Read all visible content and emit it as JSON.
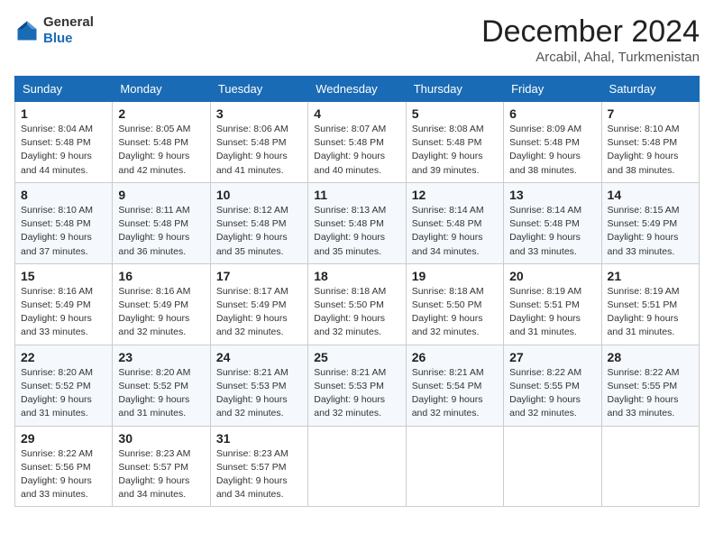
{
  "header": {
    "logo_line1": "General",
    "logo_line2": "Blue",
    "month_title": "December 2024",
    "location": "Arcabil, Ahal, Turkmenistan"
  },
  "weekdays": [
    "Sunday",
    "Monday",
    "Tuesday",
    "Wednesday",
    "Thursday",
    "Friday",
    "Saturday"
  ],
  "weeks": [
    [
      {
        "day": "1",
        "sunrise": "8:04 AM",
        "sunset": "5:48 PM",
        "daylight": "9 hours and 44 minutes."
      },
      {
        "day": "2",
        "sunrise": "8:05 AM",
        "sunset": "5:48 PM",
        "daylight": "9 hours and 42 minutes."
      },
      {
        "day": "3",
        "sunrise": "8:06 AM",
        "sunset": "5:48 PM",
        "daylight": "9 hours and 41 minutes."
      },
      {
        "day": "4",
        "sunrise": "8:07 AM",
        "sunset": "5:48 PM",
        "daylight": "9 hours and 40 minutes."
      },
      {
        "day": "5",
        "sunrise": "8:08 AM",
        "sunset": "5:48 PM",
        "daylight": "9 hours and 39 minutes."
      },
      {
        "day": "6",
        "sunrise": "8:09 AM",
        "sunset": "5:48 PM",
        "daylight": "9 hours and 38 minutes."
      },
      {
        "day": "7",
        "sunrise": "8:10 AM",
        "sunset": "5:48 PM",
        "daylight": "9 hours and 38 minutes."
      }
    ],
    [
      {
        "day": "8",
        "sunrise": "8:10 AM",
        "sunset": "5:48 PM",
        "daylight": "9 hours and 37 minutes."
      },
      {
        "day": "9",
        "sunrise": "8:11 AM",
        "sunset": "5:48 PM",
        "daylight": "9 hours and 36 minutes."
      },
      {
        "day": "10",
        "sunrise": "8:12 AM",
        "sunset": "5:48 PM",
        "daylight": "9 hours and 35 minutes."
      },
      {
        "day": "11",
        "sunrise": "8:13 AM",
        "sunset": "5:48 PM",
        "daylight": "9 hours and 35 minutes."
      },
      {
        "day": "12",
        "sunrise": "8:14 AM",
        "sunset": "5:48 PM",
        "daylight": "9 hours and 34 minutes."
      },
      {
        "day": "13",
        "sunrise": "8:14 AM",
        "sunset": "5:48 PM",
        "daylight": "9 hours and 33 minutes."
      },
      {
        "day": "14",
        "sunrise": "8:15 AM",
        "sunset": "5:49 PM",
        "daylight": "9 hours and 33 minutes."
      }
    ],
    [
      {
        "day": "15",
        "sunrise": "8:16 AM",
        "sunset": "5:49 PM",
        "daylight": "9 hours and 33 minutes."
      },
      {
        "day": "16",
        "sunrise": "8:16 AM",
        "sunset": "5:49 PM",
        "daylight": "9 hours and 32 minutes."
      },
      {
        "day": "17",
        "sunrise": "8:17 AM",
        "sunset": "5:49 PM",
        "daylight": "9 hours and 32 minutes."
      },
      {
        "day": "18",
        "sunrise": "8:18 AM",
        "sunset": "5:50 PM",
        "daylight": "9 hours and 32 minutes."
      },
      {
        "day": "19",
        "sunrise": "8:18 AM",
        "sunset": "5:50 PM",
        "daylight": "9 hours and 32 minutes."
      },
      {
        "day": "20",
        "sunrise": "8:19 AM",
        "sunset": "5:51 PM",
        "daylight": "9 hours and 31 minutes."
      },
      {
        "day": "21",
        "sunrise": "8:19 AM",
        "sunset": "5:51 PM",
        "daylight": "9 hours and 31 minutes."
      }
    ],
    [
      {
        "day": "22",
        "sunrise": "8:20 AM",
        "sunset": "5:52 PM",
        "daylight": "9 hours and 31 minutes."
      },
      {
        "day": "23",
        "sunrise": "8:20 AM",
        "sunset": "5:52 PM",
        "daylight": "9 hours and 31 minutes."
      },
      {
        "day": "24",
        "sunrise": "8:21 AM",
        "sunset": "5:53 PM",
        "daylight": "9 hours and 32 minutes."
      },
      {
        "day": "25",
        "sunrise": "8:21 AM",
        "sunset": "5:53 PM",
        "daylight": "9 hours and 32 minutes."
      },
      {
        "day": "26",
        "sunrise": "8:21 AM",
        "sunset": "5:54 PM",
        "daylight": "9 hours and 32 minutes."
      },
      {
        "day": "27",
        "sunrise": "8:22 AM",
        "sunset": "5:55 PM",
        "daylight": "9 hours and 32 minutes."
      },
      {
        "day": "28",
        "sunrise": "8:22 AM",
        "sunset": "5:55 PM",
        "daylight": "9 hours and 33 minutes."
      }
    ],
    [
      {
        "day": "29",
        "sunrise": "8:22 AM",
        "sunset": "5:56 PM",
        "daylight": "9 hours and 33 minutes."
      },
      {
        "day": "30",
        "sunrise": "8:23 AM",
        "sunset": "5:57 PM",
        "daylight": "9 hours and 34 minutes."
      },
      {
        "day": "31",
        "sunrise": "8:23 AM",
        "sunset": "5:57 PM",
        "daylight": "9 hours and 34 minutes."
      },
      null,
      null,
      null,
      null
    ]
  ],
  "labels": {
    "sunrise": "Sunrise:",
    "sunset": "Sunset:",
    "daylight": "Daylight:"
  }
}
